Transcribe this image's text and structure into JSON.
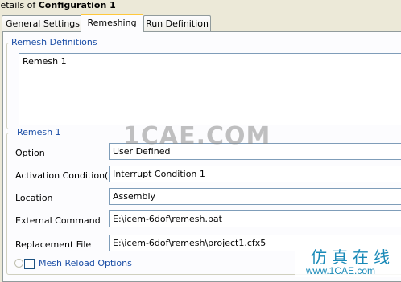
{
  "window": {
    "title_prefix": "Details of ",
    "title_name": "Configuration 1"
  },
  "tabs": [
    {
      "label": "General Settings",
      "active": false
    },
    {
      "label": "Remeshing",
      "active": true
    },
    {
      "label": "Run Definition",
      "active": false
    }
  ],
  "remesh_definitions": {
    "legend": "Remesh Definitions",
    "items": [
      "Remesh 1"
    ]
  },
  "remesh1": {
    "legend": "Remesh 1",
    "fields": [
      {
        "label": "Option",
        "value": "User Defined"
      },
      {
        "label": "Activation Condition(s)",
        "value": "Interrupt Condition 1"
      },
      {
        "label": "Location",
        "value": "Assembly"
      },
      {
        "label": "External Command",
        "value": "E:\\icem-6dof\\remesh.bat"
      },
      {
        "label": "Replacement File",
        "value": "E:\\icem-6dof\\remesh\\project1.cfx5"
      }
    ]
  },
  "mesh_reload": {
    "label": "Mesh Reload Options",
    "checked": false
  },
  "watermark": {
    "text": "1CAE.COM",
    "cn_text": "仿真在线",
    "url": "www.1CAE.com"
  }
}
